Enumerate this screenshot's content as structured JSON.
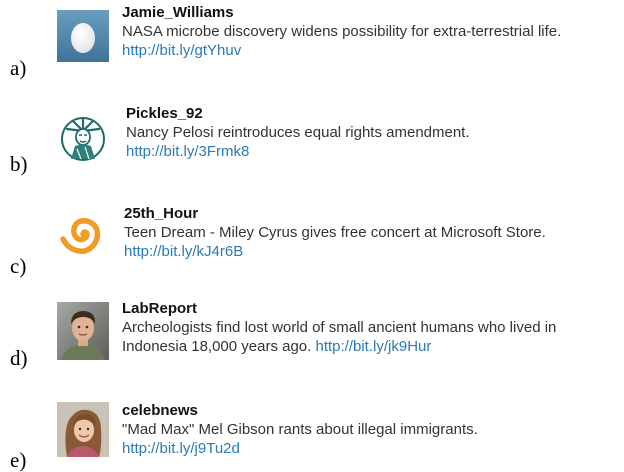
{
  "tweets": [
    {
      "letter": "a)",
      "username": "Jamie_Williams",
      "text": "NASA microbe discovery widens possibility for extra-terrestrial life.",
      "link": "http://bit.ly/gtYhuv",
      "avatar": "egg-avatar-icon"
    },
    {
      "letter": "b)",
      "username": "Pickles_92",
      "text": "Nancy Pelosi reintroduces equal rights amendment.",
      "link": "http://bit.ly/3Frmk8",
      "avatar": "statue-of-liberty-avatar-icon"
    },
    {
      "letter": "c)",
      "username": "25th_Hour",
      "text": "Teen Dream - Miley Cyrus gives free concert at Microsoft Store.",
      "link": "http://bit.ly/kJ4r6B",
      "avatar": "orange-spiral-avatar-icon"
    },
    {
      "letter": "d)",
      "username": "LabReport",
      "text_line1": "Archeologists find lost world of small ancient humans who lived in",
      "text_line2": "Indonesia 18,000 years ago.",
      "link": "http://bit.ly/jk9Hur",
      "avatar": "man-photo-avatar"
    },
    {
      "letter": "e)",
      "username": "celebnews",
      "text": "\"Mad Max\" Mel Gibson rants about illegal immigrants.",
      "link": "http://bit.ly/j9Tu2d",
      "avatar": "woman-photo-avatar"
    }
  ],
  "colors": {
    "link": "#2a7ab5",
    "egg_background": "#4f86ab",
    "spiral": "#f29a26"
  }
}
